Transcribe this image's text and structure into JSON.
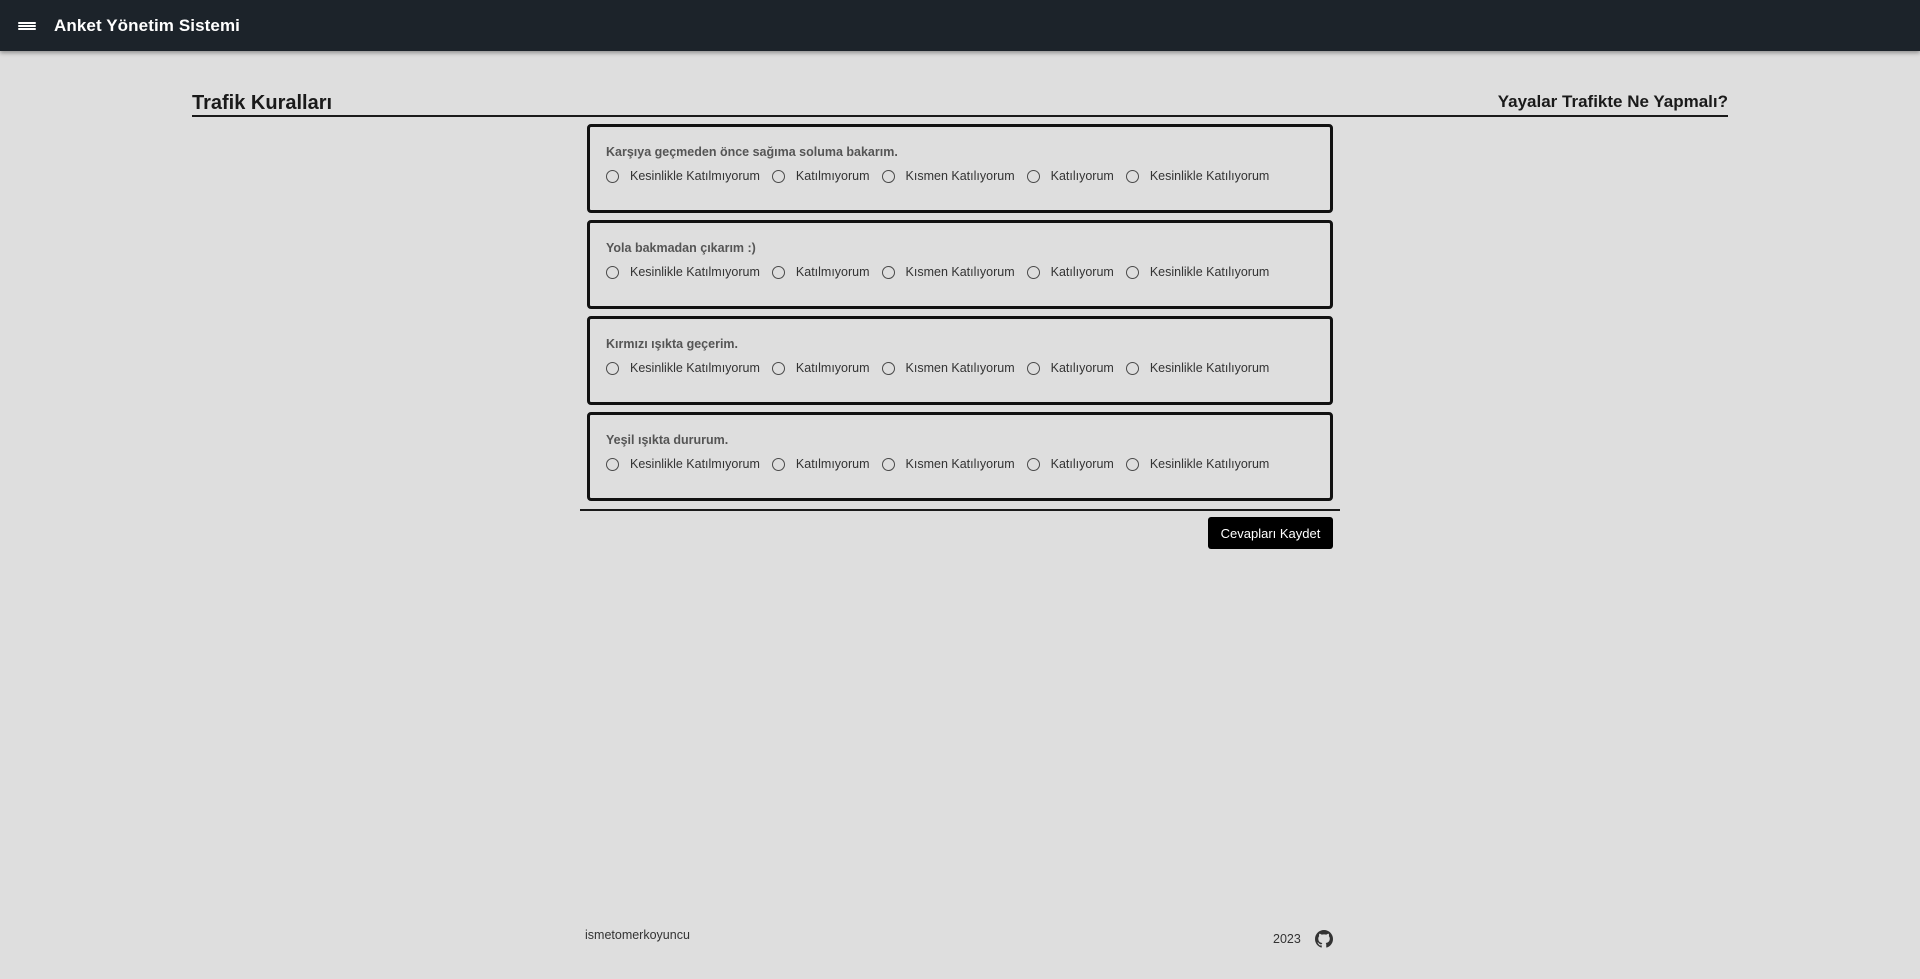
{
  "app": {
    "title": "Anket Yönetim Sistemi",
    "menu_icon": "menu-icon"
  },
  "header": {
    "category": "Trafik Kuralları",
    "survey_title": "Yayalar Trafikte Ne Yapmalı?"
  },
  "options": [
    "Kesinlikle Katılmıyorum",
    "Katılmıyorum",
    "Kısmen Katılıyorum",
    "Katılıyorum",
    "Kesinlikle Katılıyorum"
  ],
  "questions": [
    {
      "text": "Karşıya geçmeden önce sağıma soluma bakarım."
    },
    {
      "text": "Yola bakmadan çıkarım :)"
    },
    {
      "text": "Kırmızı ışıkta geçerim."
    },
    {
      "text": "Yeşil ışıkta dururum."
    }
  ],
  "actions": {
    "save_label": "Cevapları Kaydet"
  },
  "footer": {
    "author": "ismetomerkoyuncu",
    "year": "2023",
    "icon": "github-icon"
  },
  "colors": {
    "appbar": "#1c232a",
    "background": "#dedede",
    "button": "#000000"
  }
}
